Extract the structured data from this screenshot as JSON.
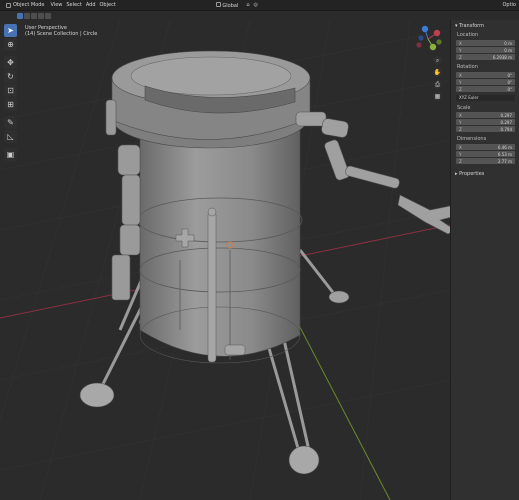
{
  "header": {
    "mode": "Object Mode",
    "menus": [
      "View",
      "Select",
      "Add",
      "Object"
    ],
    "orientation": "Global",
    "right_label": "Optio"
  },
  "viewport": {
    "perspective": "User Perspective",
    "collection": "(14) Scene Collection | Circle"
  },
  "toolbar": {
    "tools": [
      "select-box-icon",
      "cursor-icon",
      "move-icon",
      "rotate-icon",
      "scale-icon",
      "transform-icon",
      "annotate-icon",
      "measure-icon",
      "add-cube-icon"
    ]
  },
  "npanel": {
    "transform_label": "Transform",
    "location_label": "Location",
    "location": [
      {
        "axis": "X",
        "value": "0 m"
      },
      {
        "axis": "Y",
        "value": "0 m"
      },
      {
        "axis": "Z",
        "value": "6.2938 m"
      }
    ],
    "rotation_label": "Rotation",
    "rotation": [
      {
        "axis": "X",
        "value": "0°"
      },
      {
        "axis": "Y",
        "value": "0°"
      },
      {
        "axis": "Z",
        "value": "0°"
      }
    ],
    "rotation_mode": "XYZ Euler",
    "scale_label": "Scale",
    "scale": [
      {
        "axis": "X",
        "value": "0.297"
      },
      {
        "axis": "Y",
        "value": "0.297"
      },
      {
        "axis": "Z",
        "value": "0.794"
      }
    ],
    "dimensions_label": "Dimensions",
    "dimensions": [
      {
        "axis": "X",
        "value": "6.46 m"
      },
      {
        "axis": "Y",
        "value": "6.53 m"
      },
      {
        "axis": "Z",
        "value": "2.77 m"
      }
    ],
    "properties_label": "Properties"
  },
  "colors": {
    "accent": "#4772b3",
    "background": "#2b2b2b",
    "panel": "#303030",
    "x_axis": "#c04050",
    "y_axis": "#8ab33a",
    "z_axis": "#3d7bd6"
  }
}
